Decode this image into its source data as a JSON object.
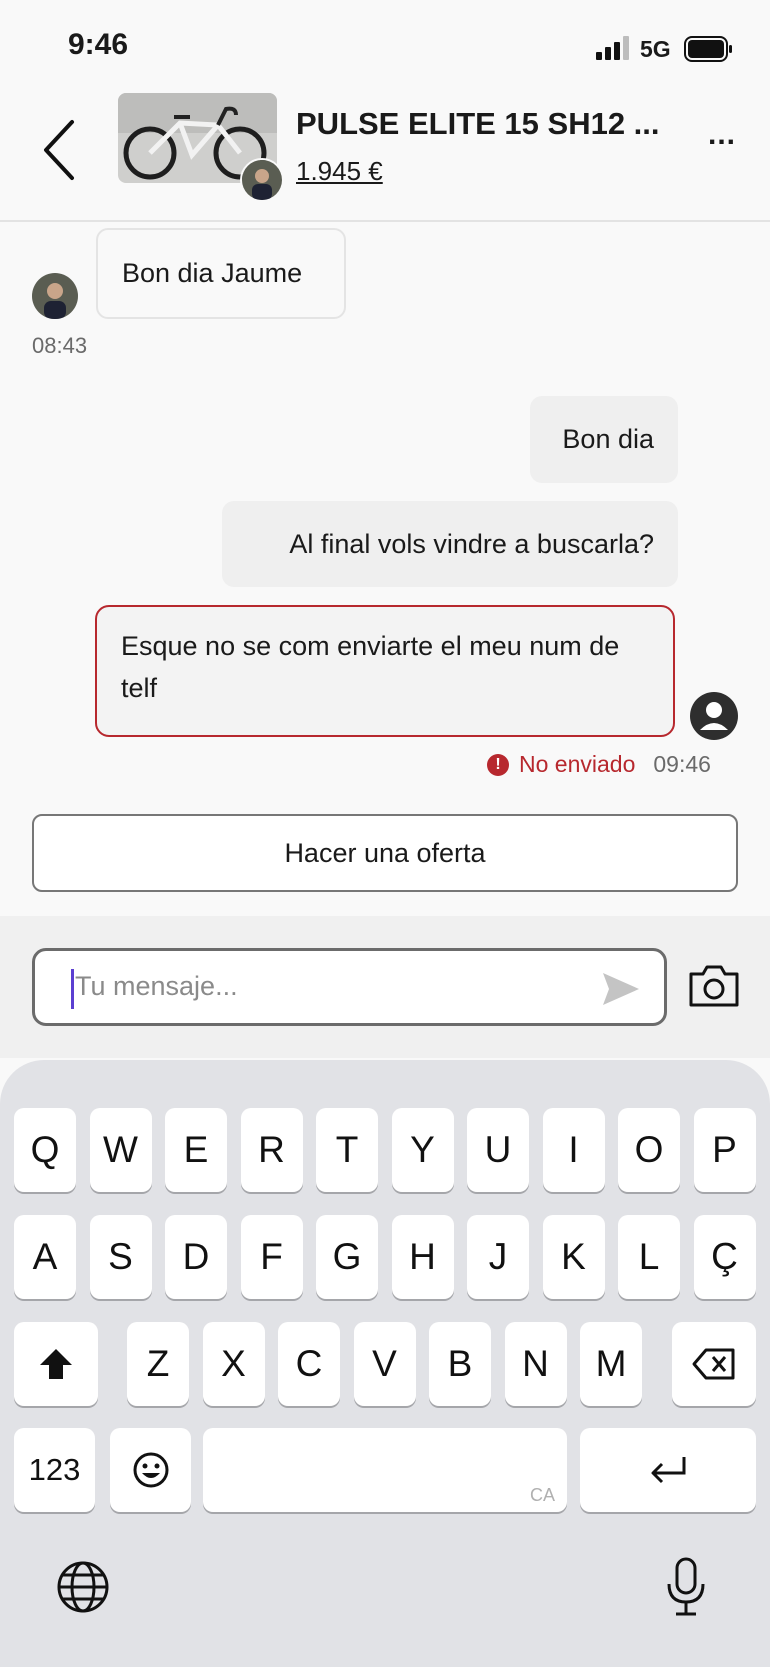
{
  "status_bar": {
    "time": "9:46",
    "network": "5G"
  },
  "header": {
    "title": "PULSE ELITE 15 SH12 ...",
    "price": "1.945 €",
    "more": "..."
  },
  "messages": {
    "incoming": {
      "text": "Bon dia Jaume",
      "time": "08:43"
    },
    "outgoing": [
      {
        "text": "Bon dia"
      },
      {
        "text": "Al final vols vindre a buscarla?"
      },
      {
        "text": "Esque no se com enviarte el meu num de telf"
      }
    ],
    "failed_label": "No enviado",
    "failed_time": "09:46",
    "failed_icon": "!"
  },
  "offer_button": "Hacer una oferta",
  "composer": {
    "placeholder": "Tu mensaje..."
  },
  "keyboard": {
    "row1": [
      "Q",
      "W",
      "E",
      "R",
      "T",
      "Y",
      "U",
      "I",
      "O",
      "P"
    ],
    "row2": [
      "A",
      "S",
      "D",
      "F",
      "G",
      "H",
      "J",
      "K",
      "L",
      "Ç"
    ],
    "row3": [
      "Z",
      "X",
      "C",
      "V",
      "B",
      "N",
      "M"
    ],
    "numbers_key": "123",
    "space_lang": "CA"
  },
  "colors": {
    "error": "#b7282e",
    "cursor": "#5b3fd1"
  }
}
